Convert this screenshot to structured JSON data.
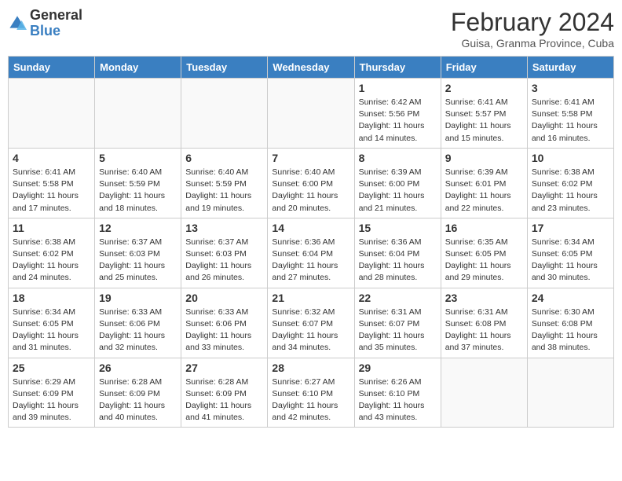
{
  "logo": {
    "text_general": "General",
    "text_blue": "Blue"
  },
  "title": "February 2024",
  "location": "Guisa, Granma Province, Cuba",
  "days_of_week": [
    "Sunday",
    "Monday",
    "Tuesday",
    "Wednesday",
    "Thursday",
    "Friday",
    "Saturday"
  ],
  "weeks": [
    [
      {
        "day": "",
        "info": ""
      },
      {
        "day": "",
        "info": ""
      },
      {
        "day": "",
        "info": ""
      },
      {
        "day": "",
        "info": ""
      },
      {
        "day": "1",
        "info": "Sunrise: 6:42 AM\nSunset: 5:56 PM\nDaylight: 11 hours and 14 minutes."
      },
      {
        "day": "2",
        "info": "Sunrise: 6:41 AM\nSunset: 5:57 PM\nDaylight: 11 hours and 15 minutes."
      },
      {
        "day": "3",
        "info": "Sunrise: 6:41 AM\nSunset: 5:58 PM\nDaylight: 11 hours and 16 minutes."
      }
    ],
    [
      {
        "day": "4",
        "info": "Sunrise: 6:41 AM\nSunset: 5:58 PM\nDaylight: 11 hours and 17 minutes."
      },
      {
        "day": "5",
        "info": "Sunrise: 6:40 AM\nSunset: 5:59 PM\nDaylight: 11 hours and 18 minutes."
      },
      {
        "day": "6",
        "info": "Sunrise: 6:40 AM\nSunset: 5:59 PM\nDaylight: 11 hours and 19 minutes."
      },
      {
        "day": "7",
        "info": "Sunrise: 6:40 AM\nSunset: 6:00 PM\nDaylight: 11 hours and 20 minutes."
      },
      {
        "day": "8",
        "info": "Sunrise: 6:39 AM\nSunset: 6:00 PM\nDaylight: 11 hours and 21 minutes."
      },
      {
        "day": "9",
        "info": "Sunrise: 6:39 AM\nSunset: 6:01 PM\nDaylight: 11 hours and 22 minutes."
      },
      {
        "day": "10",
        "info": "Sunrise: 6:38 AM\nSunset: 6:02 PM\nDaylight: 11 hours and 23 minutes."
      }
    ],
    [
      {
        "day": "11",
        "info": "Sunrise: 6:38 AM\nSunset: 6:02 PM\nDaylight: 11 hours and 24 minutes."
      },
      {
        "day": "12",
        "info": "Sunrise: 6:37 AM\nSunset: 6:03 PM\nDaylight: 11 hours and 25 minutes."
      },
      {
        "day": "13",
        "info": "Sunrise: 6:37 AM\nSunset: 6:03 PM\nDaylight: 11 hours and 26 minutes."
      },
      {
        "day": "14",
        "info": "Sunrise: 6:36 AM\nSunset: 6:04 PM\nDaylight: 11 hours and 27 minutes."
      },
      {
        "day": "15",
        "info": "Sunrise: 6:36 AM\nSunset: 6:04 PM\nDaylight: 11 hours and 28 minutes."
      },
      {
        "day": "16",
        "info": "Sunrise: 6:35 AM\nSunset: 6:05 PM\nDaylight: 11 hours and 29 minutes."
      },
      {
        "day": "17",
        "info": "Sunrise: 6:34 AM\nSunset: 6:05 PM\nDaylight: 11 hours and 30 minutes."
      }
    ],
    [
      {
        "day": "18",
        "info": "Sunrise: 6:34 AM\nSunset: 6:05 PM\nDaylight: 11 hours and 31 minutes."
      },
      {
        "day": "19",
        "info": "Sunrise: 6:33 AM\nSunset: 6:06 PM\nDaylight: 11 hours and 32 minutes."
      },
      {
        "day": "20",
        "info": "Sunrise: 6:33 AM\nSunset: 6:06 PM\nDaylight: 11 hours and 33 minutes."
      },
      {
        "day": "21",
        "info": "Sunrise: 6:32 AM\nSunset: 6:07 PM\nDaylight: 11 hours and 34 minutes."
      },
      {
        "day": "22",
        "info": "Sunrise: 6:31 AM\nSunset: 6:07 PM\nDaylight: 11 hours and 35 minutes."
      },
      {
        "day": "23",
        "info": "Sunrise: 6:31 AM\nSunset: 6:08 PM\nDaylight: 11 hours and 37 minutes."
      },
      {
        "day": "24",
        "info": "Sunrise: 6:30 AM\nSunset: 6:08 PM\nDaylight: 11 hours and 38 minutes."
      }
    ],
    [
      {
        "day": "25",
        "info": "Sunrise: 6:29 AM\nSunset: 6:09 PM\nDaylight: 11 hours and 39 minutes."
      },
      {
        "day": "26",
        "info": "Sunrise: 6:28 AM\nSunset: 6:09 PM\nDaylight: 11 hours and 40 minutes."
      },
      {
        "day": "27",
        "info": "Sunrise: 6:28 AM\nSunset: 6:09 PM\nDaylight: 11 hours and 41 minutes."
      },
      {
        "day": "28",
        "info": "Sunrise: 6:27 AM\nSunset: 6:10 PM\nDaylight: 11 hours and 42 minutes."
      },
      {
        "day": "29",
        "info": "Sunrise: 6:26 AM\nSunset: 6:10 PM\nDaylight: 11 hours and 43 minutes."
      },
      {
        "day": "",
        "info": ""
      },
      {
        "day": "",
        "info": ""
      }
    ]
  ]
}
